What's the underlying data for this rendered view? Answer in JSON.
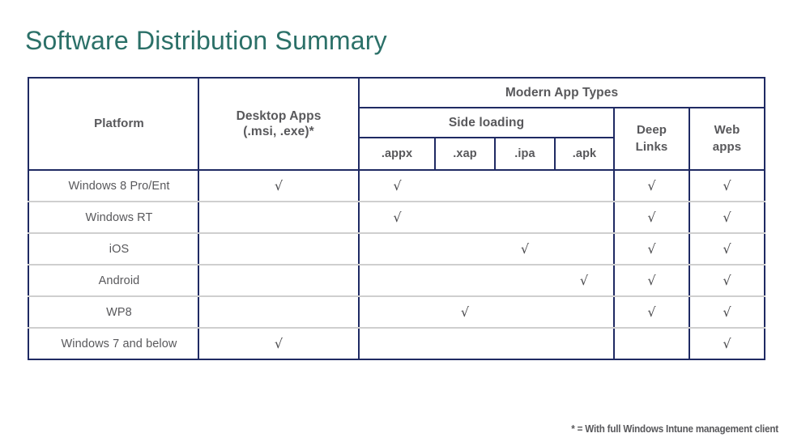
{
  "slide": {
    "title": "Software Distribution Summary",
    "title_color": "#2b7068",
    "border_color": "#1f2a63",
    "row_separator_color": "#cfcfcf",
    "text_color": "#58585b",
    "footnote": "* = With full Windows Intune management client"
  },
  "table": {
    "headers": {
      "platform": "Platform",
      "desktop_apps_line1": "Desktop Apps",
      "desktop_apps_line2": "(.msi, .exe)*",
      "modern_app_types": "Modern App Types",
      "side_loading": "Side loading",
      "appx": ".appx",
      "xap": ".xap",
      "ipa": ".ipa",
      "apk": ".apk",
      "deep_links_line1": "Deep",
      "deep_links_line2": "Links",
      "web_apps_line1": "Web",
      "web_apps_line2": "apps"
    },
    "check_glyph": "√",
    "columns": [
      "Platform",
      "Desktop Apps (.msi, .exe)*",
      ".appx",
      ".xap",
      ".ipa",
      ".apk",
      "Deep Links",
      "Web apps"
    ],
    "rows": [
      {
        "platform": "Windows 8 Pro/Ent",
        "desktop": "√",
        "appx": "√",
        "xap": "",
        "ipa": "",
        "apk": "",
        "deep_links": "√",
        "web_apps": "√"
      },
      {
        "platform": "Windows RT",
        "desktop": "",
        "appx": "√",
        "xap": "",
        "ipa": "",
        "apk": "",
        "deep_links": "√",
        "web_apps": "√"
      },
      {
        "platform": "iOS",
        "desktop": "",
        "appx": "",
        "xap": "",
        "ipa": "√",
        "apk": "",
        "deep_links": "√",
        "web_apps": "√"
      },
      {
        "platform": "Android",
        "desktop": "",
        "appx": "",
        "xap": "",
        "ipa": "",
        "apk": "√",
        "deep_links": "√",
        "web_apps": "√"
      },
      {
        "platform": "WP8",
        "desktop": "",
        "appx": "",
        "xap": "√",
        "ipa": "",
        "apk": "",
        "deep_links": "√",
        "web_apps": "√"
      },
      {
        "platform": "Windows 7 and below",
        "desktop": "√",
        "appx": "",
        "xap": "",
        "ipa": "",
        "apk": "",
        "deep_links": "",
        "web_apps": "√"
      }
    ]
  }
}
